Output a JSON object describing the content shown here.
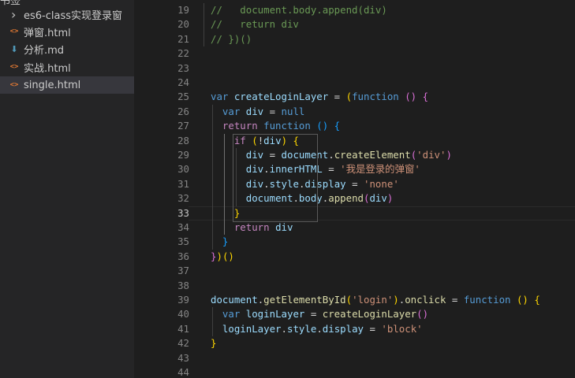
{
  "explorer": {
    "top_label": "书签",
    "items": [
      {
        "label": "es6-class实现登录窗",
        "icon": "chevron-right-icon",
        "type": "folder",
        "active": false
      },
      {
        "label": "弹窗.html",
        "icon": "html-file-icon",
        "type": "html",
        "active": false
      },
      {
        "label": "分析.md",
        "icon": "markdown-file-icon",
        "type": "md",
        "active": false
      },
      {
        "label": "实战.html",
        "icon": "html-file-icon",
        "type": "html",
        "active": false
      },
      {
        "label": "single.html",
        "icon": "html-file-icon",
        "type": "html",
        "active": true
      }
    ]
  },
  "editor": {
    "current_line": 33,
    "lines": [
      {
        "n": 19,
        "tokens": [
          {
            "t": "cm",
            "v": "//   document.body.append(div)"
          }
        ]
      },
      {
        "n": 20,
        "tokens": [
          {
            "t": "cm",
            "v": "//   return div"
          }
        ]
      },
      {
        "n": 21,
        "tokens": [
          {
            "t": "cm",
            "v": "// })()"
          }
        ]
      },
      {
        "n": 22,
        "tokens": []
      },
      {
        "n": 23,
        "tokens": []
      },
      {
        "n": 24,
        "tokens": []
      },
      {
        "n": 25,
        "tokens": [
          {
            "t": "kw",
            "v": "var "
          },
          {
            "t": "var",
            "v": "createLoginLayer"
          },
          {
            "t": "op",
            "v": " = "
          },
          {
            "t": "b1",
            "v": "("
          },
          {
            "t": "kw",
            "v": "function "
          },
          {
            "t": "b2",
            "v": "()"
          },
          {
            "t": "op",
            "v": " "
          },
          {
            "t": "b2",
            "v": "{"
          }
        ]
      },
      {
        "n": 26,
        "tokens": [
          {
            "t": "op",
            "v": "  "
          },
          {
            "t": "kw",
            "v": "var "
          },
          {
            "t": "var",
            "v": "div"
          },
          {
            "t": "op",
            "v": " = "
          },
          {
            "t": "kw",
            "v": "null"
          }
        ]
      },
      {
        "n": 27,
        "tokens": [
          {
            "t": "op",
            "v": "  "
          },
          {
            "t": "ctl",
            "v": "return "
          },
          {
            "t": "kw",
            "v": "function "
          },
          {
            "t": "b3",
            "v": "()"
          },
          {
            "t": "op",
            "v": " "
          },
          {
            "t": "b3",
            "v": "{"
          }
        ]
      },
      {
        "n": 28,
        "tokens": [
          {
            "t": "op",
            "v": "    "
          },
          {
            "t": "ctl",
            "v": "if "
          },
          {
            "t": "b1",
            "v": "("
          },
          {
            "t": "op",
            "v": "!"
          },
          {
            "t": "var",
            "v": "div"
          },
          {
            "t": "b1",
            "v": ")"
          },
          {
            "t": "op",
            "v": " "
          },
          {
            "t": "b1",
            "v": "{"
          }
        ]
      },
      {
        "n": 29,
        "tokens": [
          {
            "t": "op",
            "v": "      "
          },
          {
            "t": "var",
            "v": "div"
          },
          {
            "t": "op",
            "v": " = "
          },
          {
            "t": "var",
            "v": "document"
          },
          {
            "t": "op",
            "v": "."
          },
          {
            "t": "fn",
            "v": "createElement"
          },
          {
            "t": "b2",
            "v": "("
          },
          {
            "t": "str",
            "v": "'div'"
          },
          {
            "t": "b2",
            "v": ")"
          }
        ]
      },
      {
        "n": 30,
        "tokens": [
          {
            "t": "op",
            "v": "      "
          },
          {
            "t": "var",
            "v": "div"
          },
          {
            "t": "op",
            "v": "."
          },
          {
            "t": "var",
            "v": "innerHTML"
          },
          {
            "t": "op",
            "v": " = "
          },
          {
            "t": "str",
            "v": "'我是登录的弹窗'"
          }
        ]
      },
      {
        "n": 31,
        "tokens": [
          {
            "t": "op",
            "v": "      "
          },
          {
            "t": "var",
            "v": "div"
          },
          {
            "t": "op",
            "v": "."
          },
          {
            "t": "var",
            "v": "style"
          },
          {
            "t": "op",
            "v": "."
          },
          {
            "t": "var",
            "v": "display"
          },
          {
            "t": "op",
            "v": " = "
          },
          {
            "t": "str",
            "v": "'none'"
          }
        ]
      },
      {
        "n": 32,
        "tokens": [
          {
            "t": "op",
            "v": "      "
          },
          {
            "t": "var",
            "v": "document"
          },
          {
            "t": "op",
            "v": "."
          },
          {
            "t": "var",
            "v": "body"
          },
          {
            "t": "op",
            "v": "."
          },
          {
            "t": "fn",
            "v": "append"
          },
          {
            "t": "b2",
            "v": "("
          },
          {
            "t": "var",
            "v": "div"
          },
          {
            "t": "b2",
            "v": ")"
          }
        ]
      },
      {
        "n": 33,
        "tokens": [
          {
            "t": "op",
            "v": "    "
          },
          {
            "t": "b1",
            "v": "}"
          }
        ]
      },
      {
        "n": 34,
        "tokens": [
          {
            "t": "op",
            "v": "    "
          },
          {
            "t": "ctl",
            "v": "return "
          },
          {
            "t": "var",
            "v": "div"
          }
        ]
      },
      {
        "n": 35,
        "tokens": [
          {
            "t": "op",
            "v": "  "
          },
          {
            "t": "b3",
            "v": "}"
          }
        ]
      },
      {
        "n": 36,
        "tokens": [
          {
            "t": "b2",
            "v": "}"
          },
          {
            "t": "b1",
            "v": ")"
          },
          {
            "t": "b1",
            "v": "()"
          }
        ]
      },
      {
        "n": 37,
        "tokens": []
      },
      {
        "n": 38,
        "tokens": []
      },
      {
        "n": 39,
        "tokens": [
          {
            "t": "var",
            "v": "document"
          },
          {
            "t": "op",
            "v": "."
          },
          {
            "t": "fn",
            "v": "getElementById"
          },
          {
            "t": "b1",
            "v": "("
          },
          {
            "t": "str",
            "v": "'login'"
          },
          {
            "t": "b1",
            "v": ")"
          },
          {
            "t": "op",
            "v": "."
          },
          {
            "t": "fn",
            "v": "onclick"
          },
          {
            "t": "op",
            "v": " = "
          },
          {
            "t": "kw",
            "v": "function "
          },
          {
            "t": "b1",
            "v": "()"
          },
          {
            "t": "op",
            "v": " "
          },
          {
            "t": "b1",
            "v": "{"
          }
        ]
      },
      {
        "n": 40,
        "tokens": [
          {
            "t": "op",
            "v": "  "
          },
          {
            "t": "kw",
            "v": "var "
          },
          {
            "t": "var",
            "v": "loginLayer"
          },
          {
            "t": "op",
            "v": " = "
          },
          {
            "t": "fn",
            "v": "createLoginLayer"
          },
          {
            "t": "b2",
            "v": "()"
          }
        ]
      },
      {
        "n": 41,
        "tokens": [
          {
            "t": "op",
            "v": "  "
          },
          {
            "t": "var",
            "v": "loginLayer"
          },
          {
            "t": "op",
            "v": "."
          },
          {
            "t": "var",
            "v": "style"
          },
          {
            "t": "op",
            "v": "."
          },
          {
            "t": "var",
            "v": "display"
          },
          {
            "t": "op",
            "v": " = "
          },
          {
            "t": "str",
            "v": "'block'"
          }
        ]
      },
      {
        "n": 42,
        "tokens": [
          {
            "t": "b1",
            "v": "}"
          }
        ]
      },
      {
        "n": 43,
        "tokens": []
      },
      {
        "n": 44,
        "tokens": []
      }
    ]
  },
  "colors": {
    "background": "#1e1e1e",
    "sidebar": "#252526",
    "comment": "#6a9955",
    "keyword": "#569cd6",
    "control": "#c586c0",
    "variable": "#9cdcfe",
    "function": "#dcdcaa",
    "string": "#ce9178"
  }
}
